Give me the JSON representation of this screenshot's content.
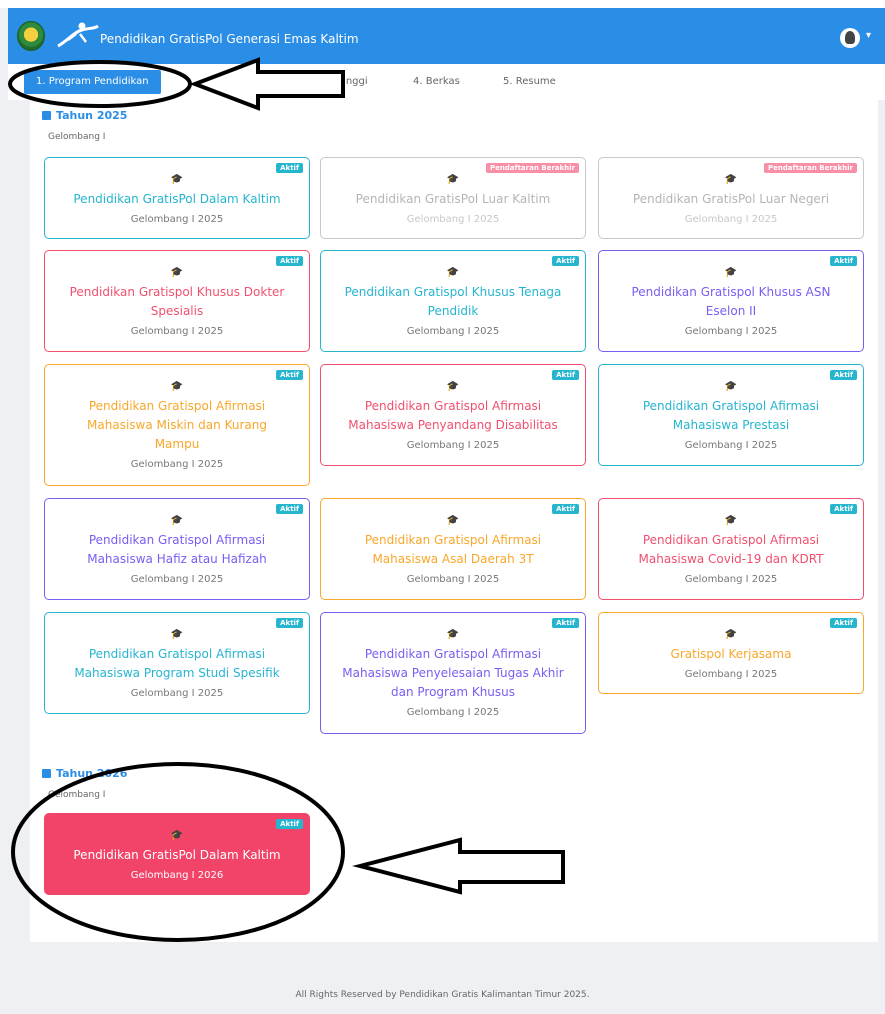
{
  "header": {
    "app_title": "Pendidikan GratisPol Generasi Emas Kaltim"
  },
  "steps": [
    {
      "label": "1. Program Pendidikan"
    },
    {
      "label": "3. Perguruan Tinggi"
    },
    {
      "label": "4. Berkas"
    },
    {
      "label": "5. Resume"
    }
  ],
  "section_2025": {
    "year": "Tahun 2025",
    "wave": "Gelombang I",
    "cards": [
      {
        "title": "Pendidikan GratisPol Dalam Kaltim",
        "sub": "Gelombang I 2025",
        "badge": "Aktif"
      },
      {
        "title": "Pendidikan GratisPol Luar Kaltim",
        "sub": "Gelombang I 2025",
        "badge": "Pendaftaran Berakhir"
      },
      {
        "title": "Pendidikan GratisPol Luar Negeri",
        "sub": "Gelombang I 2025",
        "badge": "Pendaftaran Berakhir"
      },
      {
        "title": "Pendidikan Gratispol Khusus Dokter Spesialis",
        "sub": "Gelombang I 2025",
        "badge": "Aktif"
      },
      {
        "title": "Pendidikan Gratispol Khusus Tenaga Pendidik",
        "sub": "Gelombang I 2025",
        "badge": "Aktif"
      },
      {
        "title": "Pendidikan Gratispol Khusus ASN Eselon II",
        "sub": "Gelombang I 2025",
        "badge": "Aktif"
      },
      {
        "title": "Pendidikan Gratispol Afirmasi Mahasiswa Miskin dan Kurang Mampu",
        "sub": "Gelombang I 2025",
        "badge": "Aktif"
      },
      {
        "title": "Pendidikan Gratispol Afirmasi Mahasiswa Penyandang Disabilitas",
        "sub": "Gelombang I 2025",
        "badge": "Aktif"
      },
      {
        "title": "Pendidikan Gratispol Afirmasi Mahasiswa Prestasi",
        "sub": "Gelombang I 2025",
        "badge": "Aktif"
      },
      {
        "title": "Pendidikan Gratispol Afirmasi Mahasiswa Hafiz atau Hafizah",
        "sub": "Gelombang I 2025",
        "badge": "Aktif"
      },
      {
        "title": "Pendidikan Gratispol Afirmasi Mahasiswa Asal Daerah 3T",
        "sub": "Gelombang I 2025",
        "badge": "Aktif"
      },
      {
        "title": "Pendidikan Gratispol Afirmasi Mahasiswa Covid-19 dan KDRT",
        "sub": "Gelombang I 2025",
        "badge": "Aktif"
      },
      {
        "title": "Pendidikan Gratispol Afirmasi Mahasiswa Program Studi Spesifik",
        "sub": "Gelombang I 2025",
        "badge": "Aktif"
      },
      {
        "title": "Pendidikan Gratispol Afirmasi Mahasiswa Penyelesaian Tugas Akhir dan Program Khusus",
        "sub": "Gelombang I 2025",
        "badge": "Aktif"
      },
      {
        "title": "Gratispol Kerjasama",
        "sub": "Gelombang I 2025",
        "badge": "Aktif"
      }
    ]
  },
  "section_2026": {
    "year": "Tahun 2026",
    "wave": "Gelombang I",
    "cards": [
      {
        "title": "Pendidikan GratisPol Dalam Kaltim",
        "sub": "Gelombang I 2026",
        "badge": "Aktif"
      }
    ]
  },
  "footer": {
    "text": "All Rights Reserved by Pendidikan Gratis Kalimantan Timur 2025."
  },
  "colors": {
    "primary": "#2b8ee6",
    "cyan": "#26b5cf",
    "red": "#f0506e",
    "purple": "#7b5cf2",
    "orange": "#f9a72a",
    "closed_badge": "#f78fa7"
  }
}
